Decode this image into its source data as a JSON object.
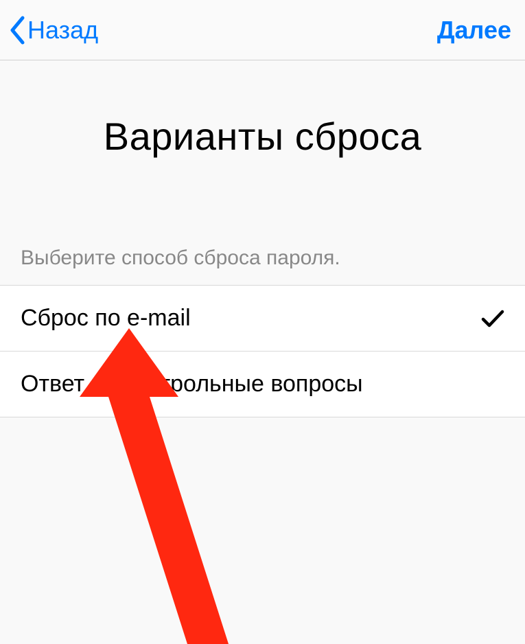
{
  "nav": {
    "back_label": "Назад",
    "next_label": "Далее"
  },
  "page": {
    "title": "Варианты сброса",
    "hint": "Выберите способ сброса пароля."
  },
  "options": {
    "email_label": "Сброс по e-mail",
    "security_questions_label": "Ответ на контрольные вопросы",
    "selected_index": 0
  },
  "colors": {
    "accent": "#007aff",
    "annotation_arrow": "#ff2a12"
  }
}
